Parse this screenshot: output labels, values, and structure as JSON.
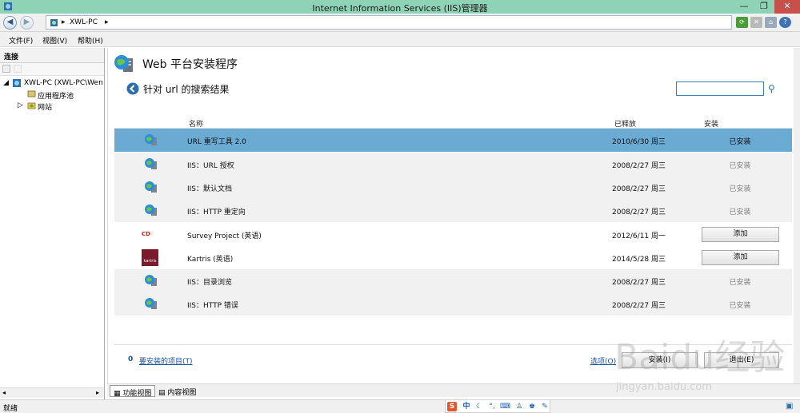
{
  "window": {
    "title": "Internet Information Services (IIS)管理器"
  },
  "address": {
    "crumbs": [
      "XWL-PC"
    ]
  },
  "menu": [
    "文件(F)",
    "视图(V)",
    "帮助(H)"
  ],
  "left": {
    "header": "连接",
    "tree": {
      "root": "XWL-PC (XWL-PC\\Wen",
      "children": [
        "应用程序池",
        "网站"
      ]
    }
  },
  "main": {
    "title": "Web 平台安装程序",
    "subtitle": "针对 url 的搜索结果",
    "search_value": "",
    "columns": {
      "name": "名称",
      "released": "已释放",
      "install": "安装"
    },
    "rows": [
      {
        "name": "URL 重写工具 2.0",
        "released": "2010/6/30 周三",
        "install": "已安装"
      },
      {
        "name": "IIS：URL 授权",
        "released": "2008/2/27 周三",
        "install": "已安装"
      },
      {
        "name": "IIS：默认文档",
        "released": "2008/2/27 周三",
        "install": "已安装"
      },
      {
        "name": "IIS：HTTP 重定向",
        "released": "2008/2/27 周三",
        "install": "已安装"
      },
      {
        "name": "Survey Project (英语)",
        "released": "2012/6/11 周一",
        "install": "添加"
      },
      {
        "name": "Kartris (英语)",
        "released": "2014/5/28 周三",
        "install": "添加"
      },
      {
        "name": "IIS：目录浏览",
        "released": "2008/2/27 周三",
        "install": "已安装"
      },
      {
        "name": "IIS：HTTP 错误",
        "released": "2008/2/27 周三",
        "install": "已安装"
      }
    ],
    "logos": {
      "survey": "CD",
      "kartris": "kartris"
    },
    "footer": {
      "count": "0",
      "items_link": "要安装的项目(T)",
      "options_link": "选项(O)",
      "install_btn": "安装(I)",
      "exit_btn": "退出(E)"
    }
  },
  "viewtabs": [
    "功能视图",
    "内容视图"
  ],
  "status": {
    "text": "就绪"
  },
  "ime": {
    "label": "中"
  },
  "watermark": {
    "text": "Baidu经验",
    "url": "jingyan.baidu.com"
  },
  "colors": {
    "selected_row": "#6baad3",
    "title_bar": "#8fd3b6",
    "link": "#1b4f9c"
  }
}
